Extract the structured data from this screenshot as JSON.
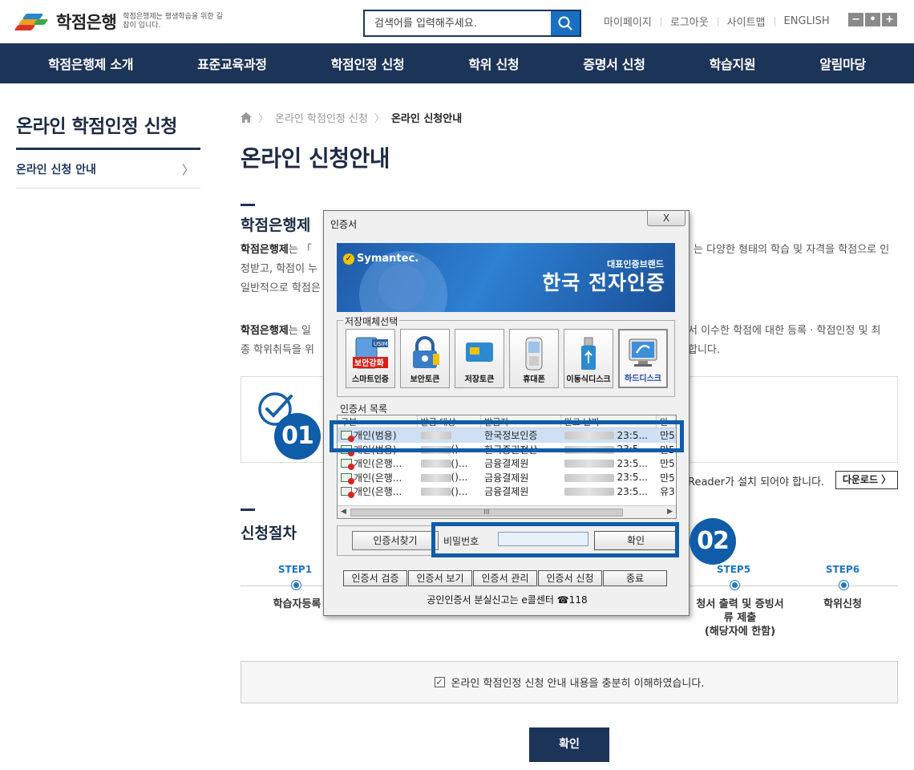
{
  "header": {
    "logo_name": "학점은행",
    "logo_sub": "학점은행제는 평생학습을 위한 길잡이 입니다.",
    "search_placeholder": "검색어를 입력해주세요.",
    "util_links": [
      "마이페이지",
      "로그아웃",
      "사이트맵",
      "ENGLISH"
    ],
    "zoom": [
      "−",
      "•",
      "+"
    ]
  },
  "gnb": [
    "학점은행제 소개",
    "표준교육과정",
    "학점인정 신청",
    "학위 신청",
    "증명서 신청",
    "학습지원",
    "알림마당"
  ],
  "lnb": {
    "title": "온라인 학점인정 신청",
    "item": "온라인 신청 안내",
    "chevron": "〉"
  },
  "breadcrumb": {
    "level1": "온라인 학점인정 신청",
    "current": "온라인 신청안내",
    "sep": "〉"
  },
  "page_title": "온라인 신청안내",
  "section1": {
    "title": "학점은행제",
    "p1_bold": "학점은행제",
    "p1_a": "는 「",
    "p1_b": "는 다양한 형태의 학습 및 자격을 학점으로 인",
    "p1_c": "정받고, 학점이 누",
    "p1_d": "일반적으로 학점은",
    "p2_bold": "학점은행제",
    "p2_a": "는 일",
    "p2_b": "서 이수한 학점에 대한 등록 · 학점인정 및 최",
    "p2_c": "종 학위취득을 위",
    "p2_d": "합니다."
  },
  "reader": {
    "text": "Reader가 설치 되어야 합니다.",
    "download": "다운로드 〉"
  },
  "section2": {
    "title": "신청절차",
    "steps": [
      {
        "label": "STEP1",
        "name": "학습자등록"
      },
      {
        "label": "STEP5",
        "name": "청서 출력 및 증빙서\n류 제출\n(해당자에 한함)"
      },
      {
        "label": "STEP6",
        "name": "학위신청"
      }
    ]
  },
  "agree": {
    "check": "✓",
    "text": "온라인 학점인정 신청 안내 내용을 충분히 이해하였습니다."
  },
  "confirm": "확인",
  "dialog": {
    "title": "인증서",
    "close": "X",
    "banner_symantec": "Symantec.",
    "banner_small": "대표인증브랜드",
    "banner_big": "한국 전자인증",
    "media_label": "저장매체선택",
    "media": [
      {
        "label": "스마트인증",
        "badge": "보안강화",
        "tag": "USIM"
      },
      {
        "label": "보안토큰"
      },
      {
        "label": "저장토큰"
      },
      {
        "label": "휴대폰"
      },
      {
        "label": "이동식디스크"
      },
      {
        "label": "하드디스크",
        "selected": true
      }
    ],
    "list_label": "인증서 목록",
    "columns": [
      "구분",
      "발급 대상",
      "발급자",
      "만료 날짜",
      "만"
    ],
    "rows": [
      {
        "type": "개인(범용)",
        "target": "",
        "issuer": "한국정보인증",
        "expiry": "23:5...",
        "extra": "만5"
      },
      {
        "type": "개인(범용)",
        "target": "()...",
        "issuer": "한국증권전산",
        "expiry": "23:5...",
        "extra": "만5"
      },
      {
        "type": "개인(은행...",
        "target": "()...",
        "issuer": "금융결제원",
        "expiry": "23:5...",
        "extra": "만5"
      },
      {
        "type": "개인(은행...",
        "target": "()...",
        "issuer": "금융결제원",
        "expiry": "23:5...",
        "extra": "만5"
      },
      {
        "type": "개인(은행...",
        "target": "()...",
        "issuer": "금융결제원",
        "expiry": "23:5...",
        "extra": "유3"
      }
    ],
    "scroll_thumb": "III",
    "find_btn": "인증서찾기",
    "pwd_label": "비밀번호",
    "ok_btn": "확인",
    "bottom_btns": [
      "인증서 검증",
      "인증서 보기",
      "인증서 관리",
      "인증서 신청",
      "종료"
    ],
    "lost_text": "공인인증서 분실신고는 e콜센터 ☎118"
  },
  "badges": [
    "01",
    "02"
  ],
  "colors": {
    "navy": "#1d3459",
    "highlight": "#0f5ca8",
    "step_blue": "#2074c4"
  }
}
